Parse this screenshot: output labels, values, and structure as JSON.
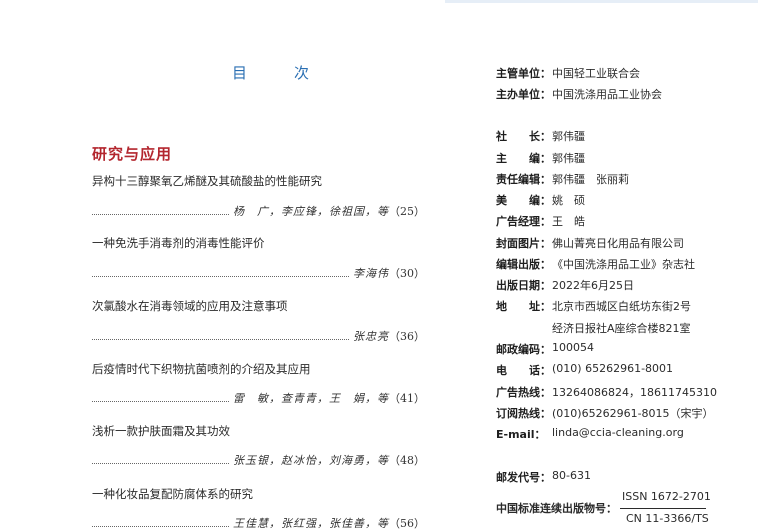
{
  "toc_title": "目　次",
  "section_title": "研究与应用",
  "entries": [
    {
      "title": "异构十三醇聚氧乙烯醚及其硫酸盐的性能研究",
      "authors": "杨　广，李应锋，徐祖国，等",
      "page": "（25）"
    },
    {
      "title": "一种免洗手消毒剂的消毒性能评价",
      "authors": "李海伟",
      "page": "（30）"
    },
    {
      "title": "次氯酸水在消毒领域的应用及注意事项",
      "authors": "张忠亮",
      "page": "（36）"
    },
    {
      "title": "后疫情时代下织物抗菌喷剂的介绍及其应用",
      "authors": "雷　敏，查青青，王　娟，等",
      "page": "（41）"
    },
    {
      "title": "浅析一款护肤面霜及其功效",
      "authors": "张玉银，赵冰怡，刘海勇，等",
      "page": "（48）"
    },
    {
      "title": "一种化妆品复配防腐体系的研究",
      "authors": "王佳慧，张红强，张佳善，等",
      "page": "（56）"
    }
  ],
  "info": [
    {
      "label": "主管单位：",
      "value": "中国轻工业联合会"
    },
    {
      "label": "主办单位：",
      "value": "中国洗涤用品工业协会"
    },
    {
      "label": "社　　长：",
      "value": "郭伟疆"
    },
    {
      "label": "主　　编：",
      "value": "郭伟疆"
    },
    {
      "label": "责任编辑：",
      "value": "郭伟疆　张丽莉"
    },
    {
      "label": "美　　编：",
      "value": "姚　硕"
    },
    {
      "label": "广告经理：",
      "value": "王　皓"
    },
    {
      "label": "封面图片：",
      "value": "佛山菁亮日化用品有限公司"
    },
    {
      "label": "编辑出版：",
      "value": "《中国洗涤用品工业》杂志社"
    },
    {
      "label": "出版日期：",
      "value": "2022年6月25日"
    },
    {
      "label": "地　　址：",
      "value": "北京市西城区白纸坊东街2号"
    },
    {
      "label": "",
      "value": "经济日报社A座综合楼821室"
    },
    {
      "label": "邮政编码：",
      "value": "100054"
    },
    {
      "label": "电　　话：",
      "value": "(010) 65262961-8001"
    },
    {
      "label": "广告热线：",
      "value": "13264086824，18611745310"
    },
    {
      "label": "订阅热线：",
      "value": "(010)65262961-8015（宋宇）"
    },
    {
      "label": "E-mail：",
      "value": "linda@ccia-cleaning.org"
    },
    {
      "label": "邮发代号：",
      "value": "80-631"
    }
  ],
  "issn": {
    "label": "中国标准连续出版物号：",
    "issn": "ISSN 1672-2701",
    "cn": "CN 11-3366/TS"
  }
}
